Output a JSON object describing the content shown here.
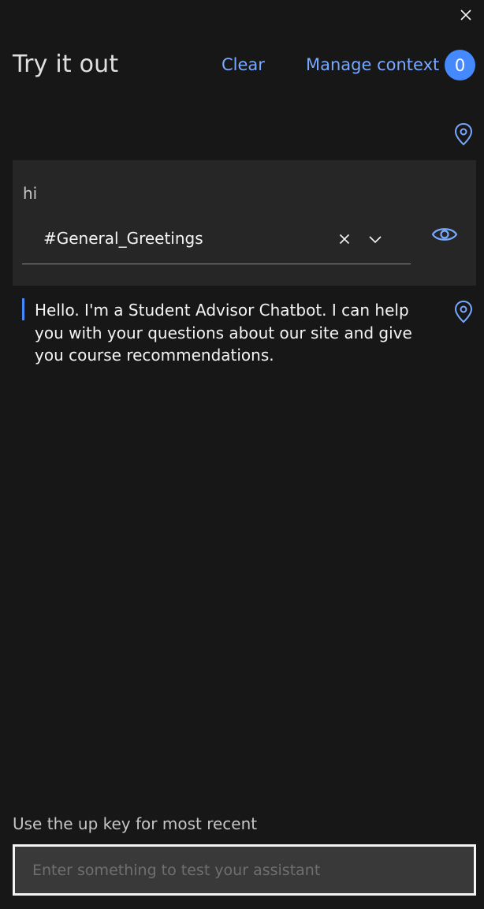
{
  "header": {
    "title": "Try it out",
    "clear_label": "Clear",
    "manage_context_label": "Manage context",
    "context_count": "0",
    "close_icon": "close-icon"
  },
  "conversation": {
    "user_message": "hi",
    "intent": {
      "value": "#General_Greetings",
      "clear_icon": "close-icon",
      "chevron_icon": "chevron-down-icon"
    },
    "eye_icon": "eye-icon",
    "bot_message": "Hello. I'm a Student Advisor Chatbot. I can help you with your questions about our site and give you course recommendations.",
    "location_icon": "location-pin-icon"
  },
  "footer": {
    "hint": "Use the up key for most recent",
    "input_placeholder": "Enter something to test your assistant",
    "input_value": ""
  },
  "colors": {
    "background": "#171717",
    "panel": "#262626",
    "link": "#78a9ff",
    "accent": "#4589ff",
    "text": "#f4f4f4"
  }
}
